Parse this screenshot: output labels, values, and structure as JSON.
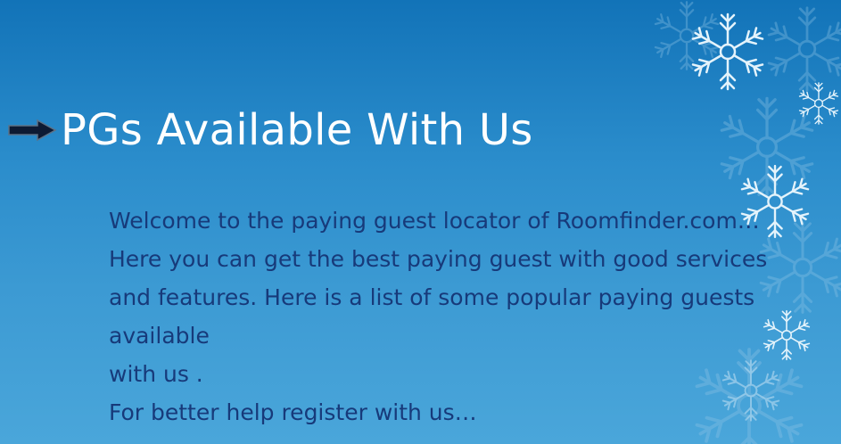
{
  "slide": {
    "title": "PGs Available With Us",
    "body_lines": [
      "Welcome to the paying guest locator of Roomfinder.com…",
      "Here you can get the best paying guest with good services",
      "and features. Here is a list of some popular paying guests",
      "available",
      "with us .",
      "For better help register with us…"
    ]
  },
  "icons": {
    "bullet": "arrow-right-icon",
    "decoration": "snowflake-icon"
  },
  "colors": {
    "background_top": "#1273b8",
    "background_bottom": "#4aa6da",
    "title": "#ffffff",
    "body_text": "#173a7a",
    "arrow_fill": "#0d1a33"
  }
}
